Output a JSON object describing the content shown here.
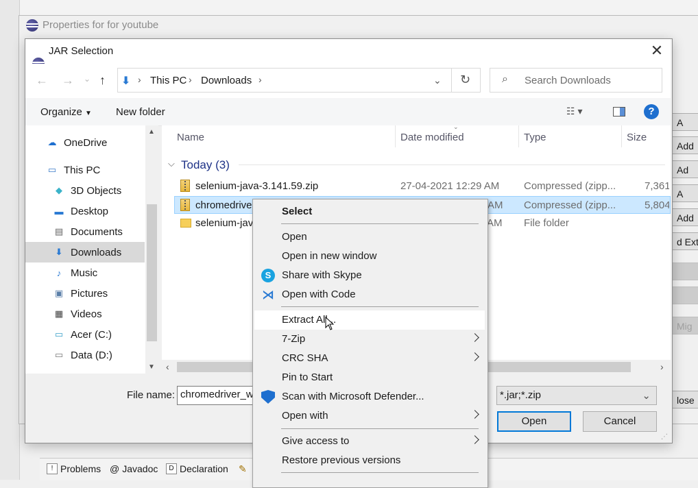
{
  "properties": {
    "title": "Properties for for youtube",
    "right_buttons": [
      "A",
      "Add",
      "Ad",
      "A",
      "Add",
      "d Exte",
      "",
      "",
      "Mig"
    ],
    "close_label": "lose"
  },
  "dialog": {
    "title": "JAR Selection",
    "breadcrumb": [
      "This PC",
      "Downloads"
    ],
    "search_placeholder": "Search Downloads",
    "toolbar": {
      "organize": "Organize",
      "new_folder": "New folder"
    },
    "nav": [
      {
        "label": "OneDrive",
        "icon": "cloud-icon"
      },
      {
        "label": "This PC",
        "icon": "computer-icon"
      },
      {
        "label": "3D Objects",
        "icon": "cube-icon"
      },
      {
        "label": "Desktop",
        "icon": "desktop-icon"
      },
      {
        "label": "Documents",
        "icon": "document-icon"
      },
      {
        "label": "Downloads",
        "icon": "download-arrow-icon",
        "selected": true
      },
      {
        "label": "Music",
        "icon": "music-note-icon"
      },
      {
        "label": "Pictures",
        "icon": "picture-icon"
      },
      {
        "label": "Videos",
        "icon": "film-icon"
      },
      {
        "label": "Acer (C:)",
        "icon": "drive-icon"
      },
      {
        "label": "Data (D:)",
        "icon": "drive-icon"
      }
    ],
    "columns": {
      "name": "Name",
      "date": "Date modified",
      "type": "Type",
      "size": "Size"
    },
    "group": "Today (3)",
    "files": [
      {
        "name": "selenium-java-3.141.59.zip",
        "date": "27-04-2021 12:29 AM",
        "type": "Compressed (zipp...",
        "size": "7,361"
      },
      {
        "name": "chromedrive",
        "date": "AM",
        "type": "Compressed (zipp...",
        "size": "5,804"
      },
      {
        "name": "selenium-jav",
        "date": "AM",
        "type": "File folder",
        "size": ""
      }
    ],
    "file_name_label": "File name:",
    "file_name_value": "chromedriver_w",
    "filter_value": "*.jar;*.zip",
    "open_label": "Open",
    "cancel_label": "Cancel"
  },
  "context_menu": [
    {
      "label": "Select",
      "bold": true
    },
    {
      "label": "Open"
    },
    {
      "label": "Open in new window"
    },
    {
      "label": "Share with Skype",
      "icon": "skype-icon"
    },
    {
      "label": "Open with Code",
      "icon": "vscode-icon"
    },
    {
      "label": "Extract All...",
      "hover": true
    },
    {
      "label": "7-Zip",
      "submenu": true
    },
    {
      "label": "CRC SHA",
      "submenu": true
    },
    {
      "label": "Pin to Start"
    },
    {
      "label": "Scan with Microsoft Defender...",
      "icon": "defender-shield-icon"
    },
    {
      "label": "Open with",
      "submenu": true
    },
    {
      "label": "Give access to",
      "submenu": true
    },
    {
      "label": "Restore previous versions"
    }
  ],
  "bottom_tabs": [
    "Problems",
    "Javadoc",
    "Declaration"
  ]
}
